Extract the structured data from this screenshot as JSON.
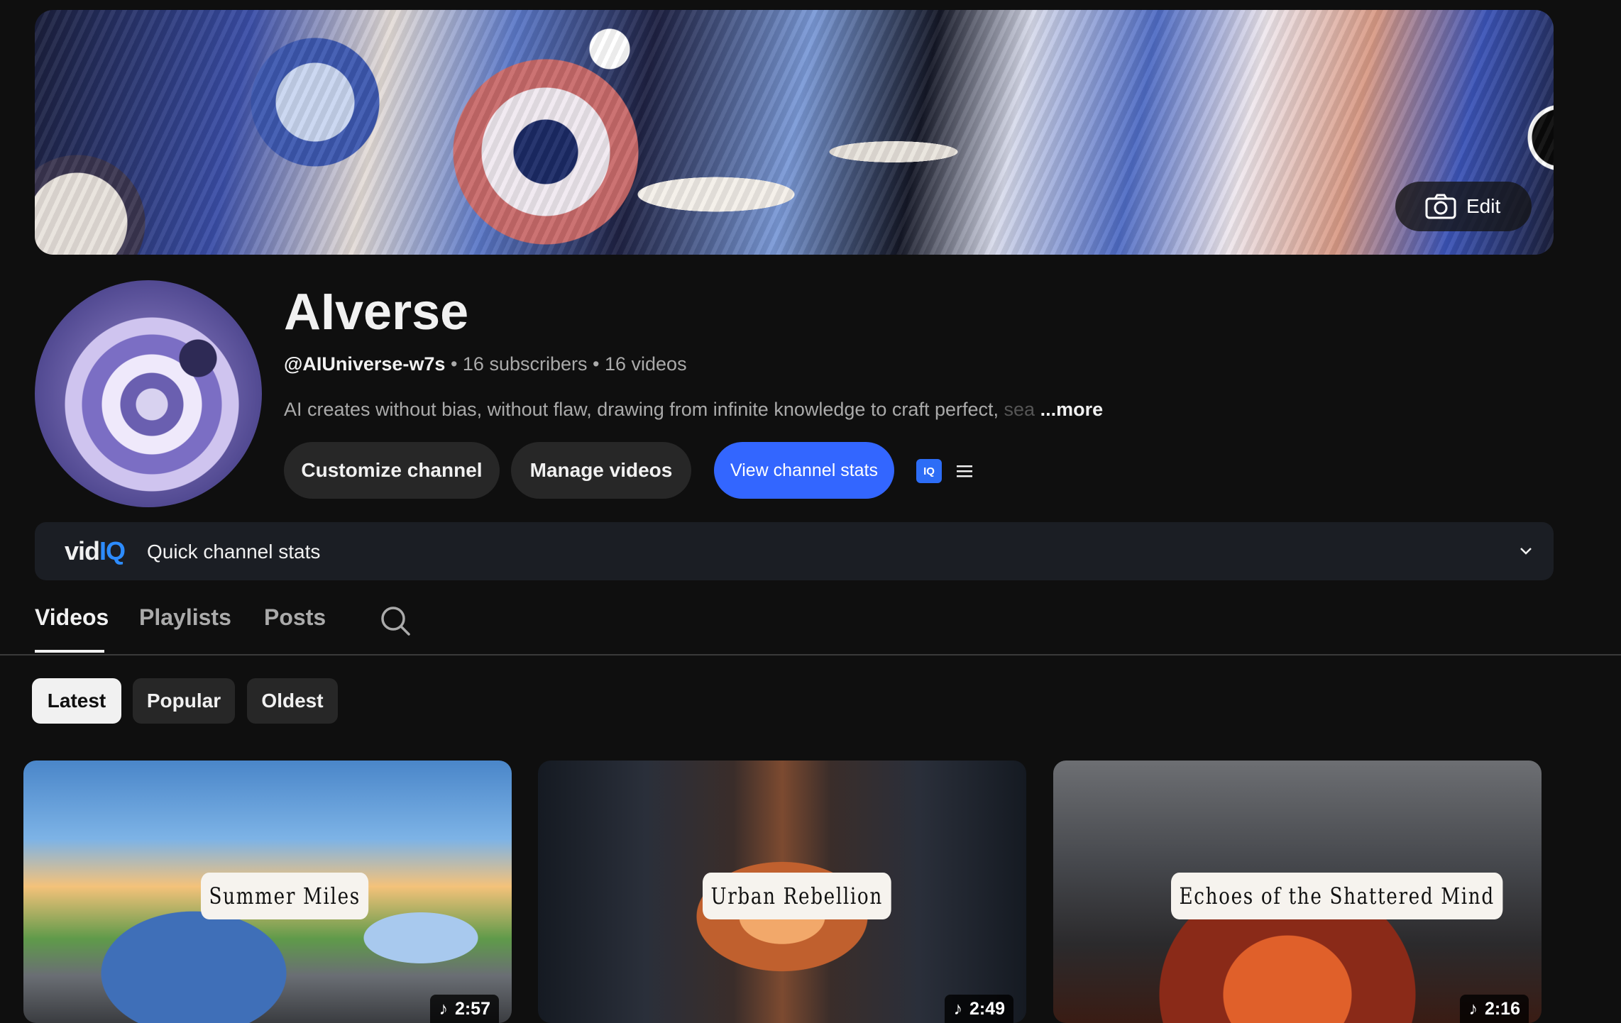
{
  "banner": {
    "edit_label": "Edit"
  },
  "channel": {
    "name": "AIverse",
    "handle": "@AIUniverse-w7s",
    "subscribers": "16 subscribers",
    "videos_count": "16 videos",
    "separator": "•",
    "description": "AI creates without bias, without flaw, drawing from infinite knowledge to craft perfect, ",
    "description_fade": "sea",
    "more_label": "...more"
  },
  "actions": {
    "customize": "Customize channel",
    "manage": "Manage videos",
    "stats": "View channel stats",
    "iq_badge": "IQ"
  },
  "vidiq": {
    "logo_vid": "vid",
    "logo_iq": "IQ",
    "title": "Quick channel stats"
  },
  "tabs": [
    {
      "label": "Videos",
      "active": true
    },
    {
      "label": "Playlists",
      "active": false
    },
    {
      "label": "Posts",
      "active": false
    }
  ],
  "chips": [
    {
      "label": "Latest",
      "active": true
    },
    {
      "label": "Popular",
      "active": false
    },
    {
      "label": "Oldest",
      "active": false
    }
  ],
  "videos": [
    {
      "title": "Summer Miles",
      "duration": "2:57"
    },
    {
      "title": "Urban Rebellion",
      "duration": "2:49"
    },
    {
      "title": "Echoes of the Shattered Mind",
      "duration": "2:16"
    }
  ],
  "colors": {
    "background": "#0f0f0f",
    "accent_blue": "#3366ff",
    "vidiq_blue": "#2d8cff",
    "button_dark": "#272727"
  },
  "icons": [
    "camera-icon",
    "iq-icon",
    "menu-icon",
    "chevron-down-icon",
    "search-icon",
    "music-note-icon"
  ]
}
